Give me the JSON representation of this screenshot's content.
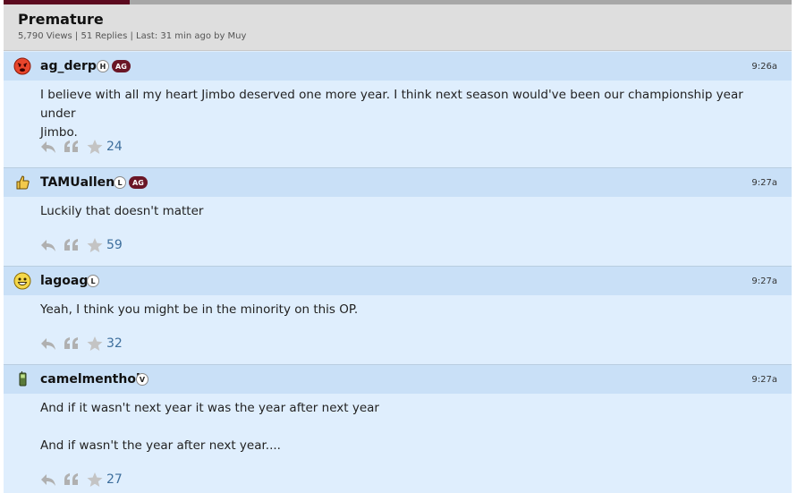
{
  "progress": {
    "fraction": 0.16
  },
  "colors": {
    "accent": "#5c0a1f",
    "link": "#3e6f9d",
    "post_bg": "#dfeefd",
    "post_head_bg": "#c9e0f7",
    "ag_badge": "#6a1626"
  },
  "thread": {
    "title": "Premature",
    "meta": "5,790 Views | 51 Replies | Last: 31 min ago by Muy"
  },
  "posts": [
    {
      "username": "ag_derp",
      "avatar_icon": "angry-red-face-icon",
      "badges": [
        "H",
        "AG"
      ],
      "time": "9:26a",
      "lines": [
        "I believe with all my heart Jimbo deserved one more year. I think next season would've been our championship year under",
        "Jimbo."
      ],
      "stars": "24"
    },
    {
      "username": "TAMUallen",
      "avatar_icon": "thumbs-up-icon",
      "badges": [
        "L",
        "AG"
      ],
      "time": "9:27a",
      "lines": [
        "Luckily that doesn't matter"
      ],
      "stars": "59"
    },
    {
      "username": "lagoag",
      "avatar_icon": "smiley-face-icon",
      "badges": [
        "L"
      ],
      "time": "9:27a",
      "lines": [
        "Yeah, I think you might be in the minority on this OP."
      ],
      "stars": "32"
    },
    {
      "username": "camelmenthol",
      "avatar_icon": "cellphone-icon",
      "badges": [
        "V"
      ],
      "time": "9:27a",
      "lines": [
        "And if it wasn't next year it was the year after next year",
        "",
        "And if wasn't the year after next year...."
      ],
      "stars": "27"
    }
  ]
}
